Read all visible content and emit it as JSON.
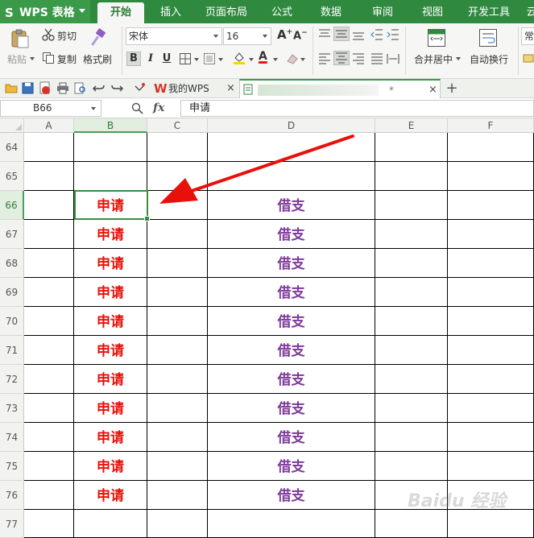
{
  "app": {
    "title": "WPS 表格"
  },
  "ribbon_tabs": [
    "开始",
    "插入",
    "页面布局",
    "公式",
    "数据",
    "审阅",
    "视图",
    "开发工具",
    "云"
  ],
  "ribbon": {
    "paste": "粘贴",
    "cut": "剪切",
    "copy": "复制",
    "format_painter": "格式刷",
    "font_name": "宋体",
    "font_size": "16",
    "bold": "B",
    "italic": "I",
    "underline": "U",
    "merge_center": "合并居中",
    "wrap_text": "自动换行",
    "common": "常"
  },
  "doc_tabs": {
    "home": "我的WPS",
    "current": "*"
  },
  "formula_bar": {
    "cell_ref": "B66",
    "fx": "fx",
    "content": "申请"
  },
  "columns": [
    "A",
    "B",
    "C",
    "D",
    "E",
    "F"
  ],
  "rows": [
    {
      "num": "64",
      "b": "",
      "d": ""
    },
    {
      "num": "65",
      "b": "",
      "d": ""
    },
    {
      "num": "66",
      "b": "申请",
      "d": "借支"
    },
    {
      "num": "67",
      "b": "申请",
      "d": "借支"
    },
    {
      "num": "68",
      "b": "申请",
      "d": "借支"
    },
    {
      "num": "69",
      "b": "申请",
      "d": "借支"
    },
    {
      "num": "70",
      "b": "申请",
      "d": "借支"
    },
    {
      "num": "71",
      "b": "申请",
      "d": "借支"
    },
    {
      "num": "72",
      "b": "申请",
      "d": "借支"
    },
    {
      "num": "73",
      "b": "申请",
      "d": "借支"
    },
    {
      "num": "74",
      "b": "申请",
      "d": "借支"
    },
    {
      "num": "75",
      "b": "申请",
      "d": "借支"
    },
    {
      "num": "76",
      "b": "申请",
      "d": "借支"
    },
    {
      "num": "77",
      "b": "",
      "d": ""
    }
  ],
  "selected": {
    "column": "B",
    "row": "66"
  },
  "colors": {
    "accent": "#2f8a3f",
    "red_text": "#e8100a",
    "purple_text": "#7d3a9a",
    "arrow": "#e8100a"
  },
  "watermark": "Baidu 经验"
}
